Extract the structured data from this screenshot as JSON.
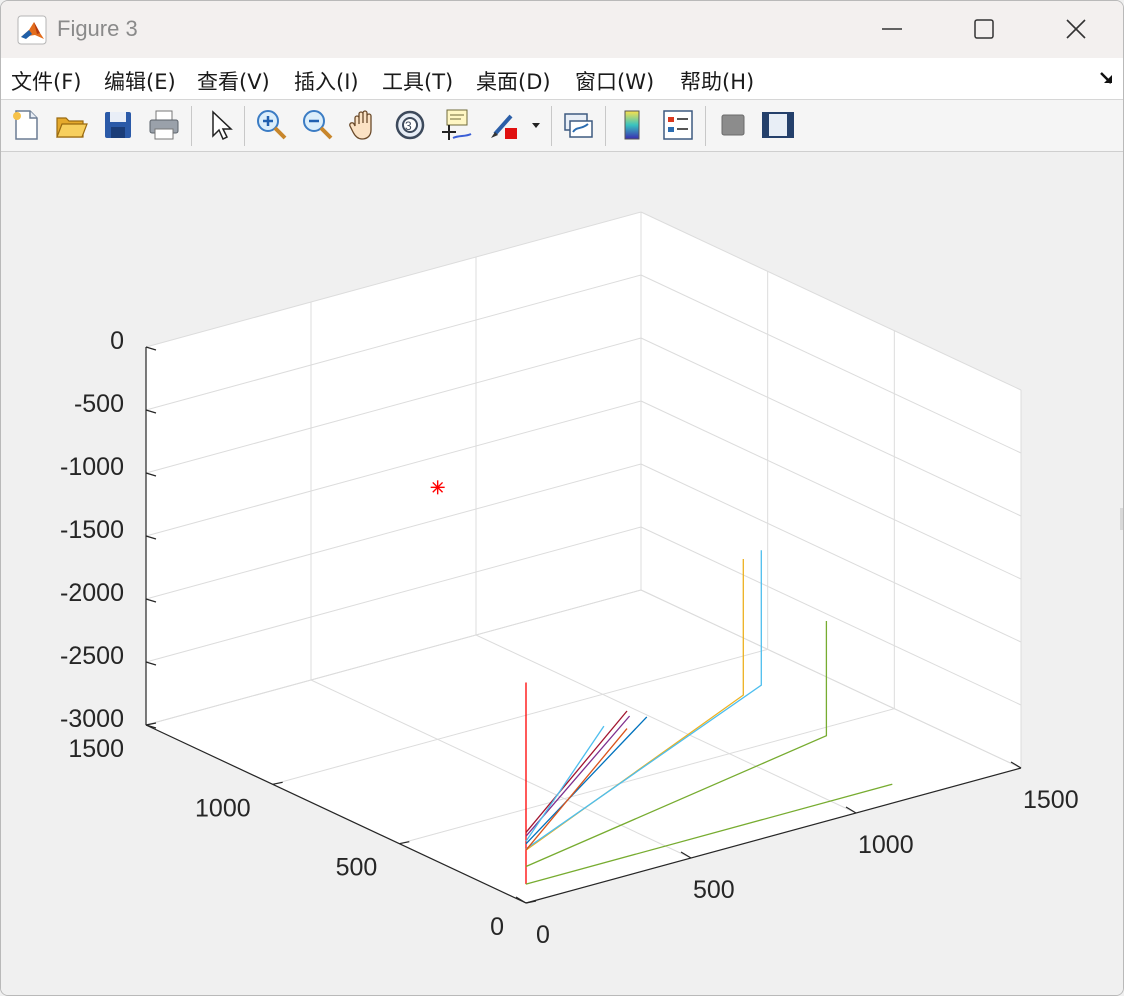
{
  "window": {
    "title": "Figure 3",
    "app_icon": "matlab-icon",
    "controls": [
      "minimize-icon",
      "maximize-icon",
      "close-icon"
    ]
  },
  "menu": {
    "items": [
      {
        "label": "文件(F)"
      },
      {
        "label": "编辑(E)"
      },
      {
        "label": "查看(V)"
      },
      {
        "label": "插入(I)"
      },
      {
        "label": "工具(T)"
      },
      {
        "label": "桌面(D)"
      },
      {
        "label": "窗口(W)"
      },
      {
        "label": "帮助(H)"
      }
    ],
    "corner_icon": "dock-arrow-icon"
  },
  "toolbar": {
    "buttons": [
      "new-figure-icon",
      "open-file-icon",
      "save-icon",
      "print-icon",
      "edit-plot-icon",
      "zoom-in-icon",
      "zoom-out-icon",
      "pan-icon",
      "rotate-3d-icon",
      "data-cursor-icon",
      "brush-icon",
      "brush-dropdown-icon",
      "link-plot-icon",
      "colorbar-icon",
      "legend-icon",
      "hide-plot-tools-icon",
      "show-plot-tools-icon"
    ]
  },
  "colors": {
    "accent_red": "#ff0000",
    "series_green": "#77ac30",
    "series_orange": "#edb120",
    "series_blue": "#4dbeee",
    "series_purple": "#7e2f8e",
    "series_darkblue": "#0072bd",
    "series_darkred": "#a2142f",
    "series_redorange": "#d95319"
  },
  "chart_data": {
    "type": "line3d",
    "title": "",
    "xlabel": "",
    "ylabel": "",
    "zlabel": "",
    "grid": true,
    "xlim": [
      0,
      1500
    ],
    "ylim": [
      0,
      1500
    ],
    "zlim": [
      -3000,
      0
    ],
    "x_ticks": [
      "0",
      "500",
      "1000",
      "1500"
    ],
    "y_ticks": [
      "0",
      "500",
      "1000",
      "1500"
    ],
    "z_ticks": [
      "0",
      "-500",
      "-1000",
      "-1500",
      "-2000",
      "-2500",
      "-3000"
    ],
    "tick_values": {
      "x": [
        0,
        500,
        1000,
        1500
      ],
      "y": [
        0,
        500,
        1000,
        1500
      ],
      "z": [
        0,
        -500,
        -1000,
        -1500,
        -2000,
        -2500,
        -3000
      ]
    },
    "view": {
      "azimuth": -37.5,
      "elevation": 30
    },
    "series": [
      {
        "color": "#ff0000",
        "kind": "line",
        "points": [
          [
            0,
            0,
            -2850
          ],
          [
            0,
            0,
            -1250
          ]
        ]
      },
      {
        "color": "#77ac30",
        "kind": "line",
        "points": [
          [
            0,
            0,
            -2850
          ],
          [
            1110,
            0,
            -2850
          ]
        ]
      },
      {
        "color": "#77ac30",
        "kind": "line",
        "points": [
          [
            0,
            0,
            -2710
          ],
          [
            1110,
            260,
            -2710
          ],
          [
            1110,
            260,
            -1800
          ]
        ]
      },
      {
        "color": "#edb120",
        "kind": "line",
        "points": [
          [
            0,
            0,
            -2580
          ],
          [
            1050,
            510,
            -2580
          ],
          [
            1050,
            510,
            -1500
          ]
        ]
      },
      {
        "color": "#4dbeee",
        "kind": "line",
        "points": [
          [
            0,
            0,
            -2570
          ],
          [
            1120,
            530,
            -2570
          ],
          [
            1120,
            530,
            -1500
          ]
        ]
      },
      {
        "color": "#0072bd",
        "kind": "line",
        "points": [
          [
            0,
            0,
            -2530
          ],
          [
            750,
            500,
            -2530
          ]
        ]
      },
      {
        "color": "#7e2f8e",
        "kind": "line",
        "points": [
          [
            0,
            0,
            -2470
          ],
          [
            690,
            490,
            -2470
          ]
        ]
      },
      {
        "color": "#a2142f",
        "kind": "line",
        "points": [
          [
            0,
            0,
            -2440
          ],
          [
            690,
            500,
            -2440
          ]
        ]
      },
      {
        "color": "#d95319",
        "kind": "line",
        "points": [
          [
            0,
            0,
            -2580
          ],
          [
            690,
            500,
            -2580
          ]
        ]
      },
      {
        "color": "#4dbeee",
        "kind": "line",
        "points": [
          [
            0,
            0,
            -2510
          ],
          [
            620,
            500,
            -2510
          ]
        ]
      },
      {
        "color": "#ff0000",
        "kind": "marker",
        "marker": "*",
        "points": [
          [
            500,
            1000,
            -1000
          ]
        ]
      }
    ]
  }
}
